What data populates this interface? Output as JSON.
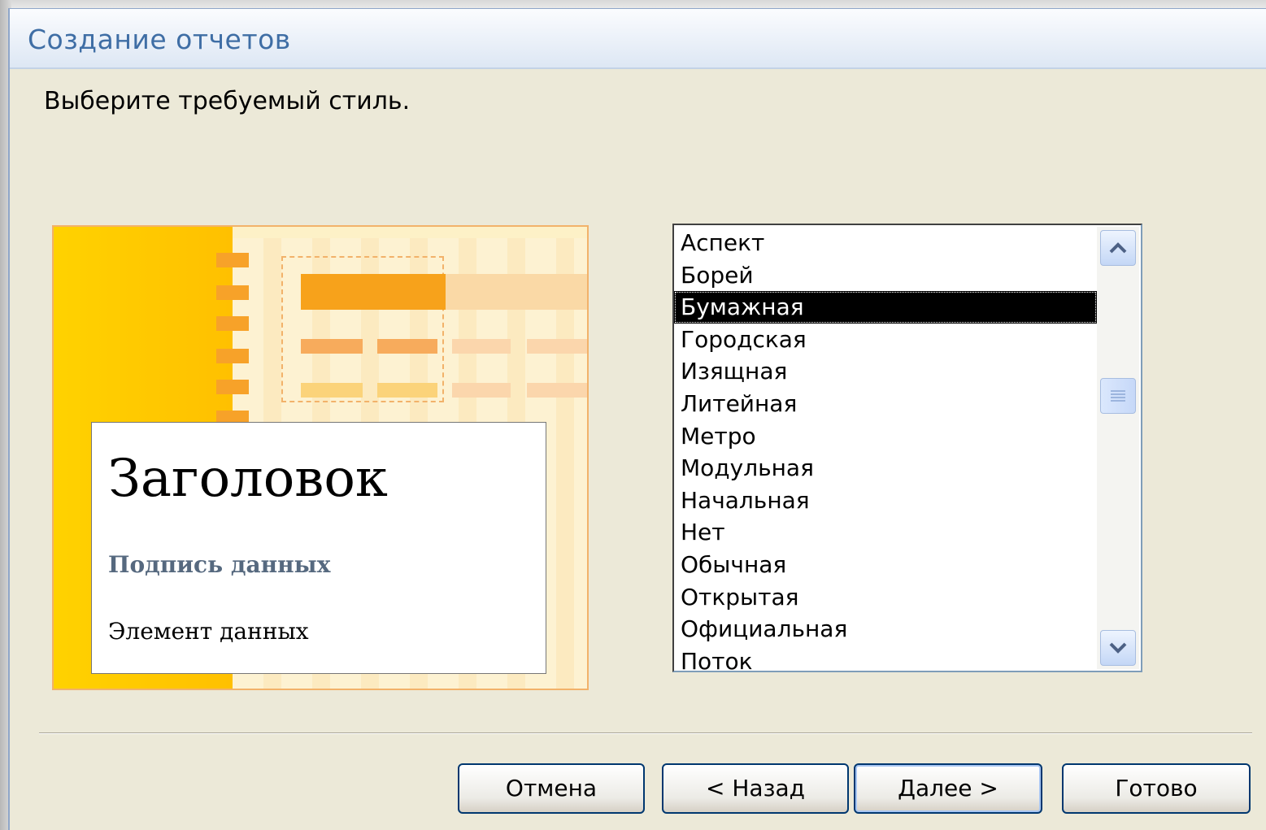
{
  "dialog": {
    "title": "Создание отчетов",
    "instruction": "Выберите требуемый стиль."
  },
  "preview": {
    "heading": "Заголовок",
    "caption": "Подпись данных",
    "element": "Элемент данных"
  },
  "style_list": {
    "items": [
      "Аспект",
      "Борей",
      "Бумажная",
      "Городская",
      "Изящная",
      "Литейная",
      "Метро",
      "Модульная",
      "Начальная",
      "Нет",
      "Обычная",
      "Открытая",
      "Официальная",
      "Поток"
    ],
    "selected": "Бумажная"
  },
  "buttons": {
    "cancel": "Отмена",
    "back": "< Назад",
    "next": "Далее >",
    "finish": "Готово"
  },
  "colors": {
    "title": "#3f6ea5",
    "selection": "#000000",
    "preview_accent": "#ffc000"
  },
  "icons": {
    "scroll_up": "chevron-up-icon",
    "scroll_down": "chevron-down-icon"
  }
}
